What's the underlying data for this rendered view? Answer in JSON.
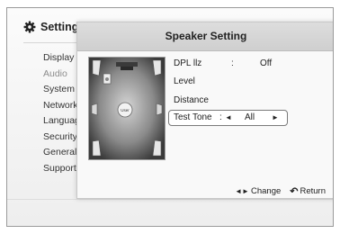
{
  "settings_menu": {
    "title": "Settings",
    "items": [
      {
        "label": "Display",
        "dim": false
      },
      {
        "label": "Audio",
        "dim": true
      },
      {
        "label": "System",
        "dim": false
      },
      {
        "label": "Network",
        "dim": false
      },
      {
        "label": "Language",
        "dim": false
      },
      {
        "label": "Security",
        "dim": false
      },
      {
        "label": "General",
        "dim": false
      },
      {
        "label": "Support",
        "dim": false
      }
    ]
  },
  "dialog": {
    "title": "Speaker Setting",
    "room_label": "User",
    "options": {
      "dpl": {
        "label": "DPL llz",
        "colon": ":",
        "value": "Off"
      },
      "level": {
        "label": "Level"
      },
      "distance": {
        "label": "Distance"
      },
      "test_tone": {
        "label": "Test Tone",
        "colon": ":",
        "value": "All",
        "left_arrow": "◄",
        "right_arrow": "►"
      }
    },
    "footer": {
      "change_icon": "◄►",
      "change_label": "Change",
      "return_icon": "↶",
      "return_label": "Return"
    }
  },
  "icons": {
    "settings": "gear-icon",
    "return": "return-icon",
    "change": "left-right-arrows-icon"
  }
}
